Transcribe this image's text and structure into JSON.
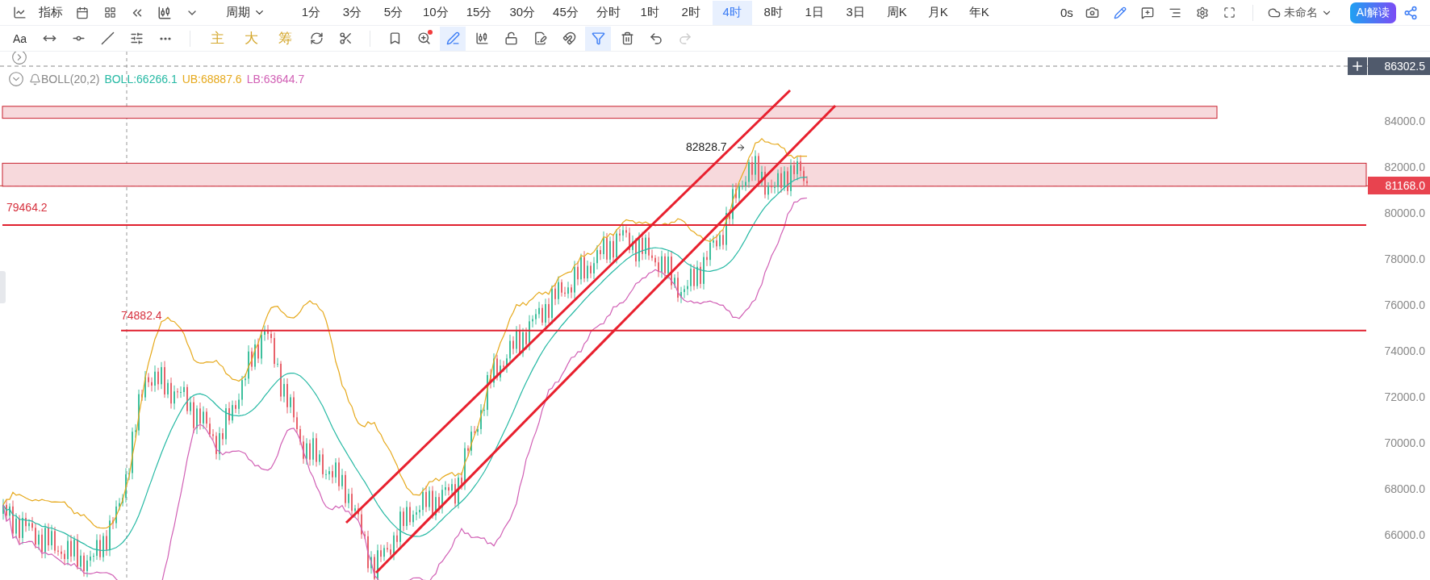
{
  "toolbar": {
    "indicator_label": "指标",
    "period_label": "周期",
    "periods": [
      {
        "label": "1分",
        "selected": false
      },
      {
        "label": "3分",
        "selected": false
      },
      {
        "label": "5分",
        "selected": false
      },
      {
        "label": "10分",
        "selected": false
      },
      {
        "label": "15分",
        "selected": false
      },
      {
        "label": "30分",
        "selected": false
      },
      {
        "label": "45分",
        "selected": false
      },
      {
        "label": "分时",
        "selected": false
      },
      {
        "label": "1时",
        "selected": false
      },
      {
        "label": "2时",
        "selected": false
      },
      {
        "label": "4时",
        "selected": true
      },
      {
        "label": "8时",
        "selected": false
      },
      {
        "label": "1日",
        "selected": false
      },
      {
        "label": "3日",
        "selected": false
      },
      {
        "label": "周K",
        "selected": false
      },
      {
        "label": "月K",
        "selected": false
      },
      {
        "label": "年K",
        "selected": false
      }
    ],
    "timer": "0s",
    "layout_name": "未命名",
    "ai_button": "AI解读"
  },
  "drawing_toolbar": {
    "font_label": "Aa",
    "chips": [
      "主",
      "大",
      "筹"
    ],
    "tools": [
      {
        "selected": false,
        "dot": false
      },
      {
        "selected": false,
        "dot": false
      },
      {
        "selected": false,
        "dot": false
      },
      {
        "selected": false,
        "dot": false
      },
      {
        "selected": false,
        "dot": false
      },
      {
        "selected": false,
        "dot": false
      },
      {
        "selected": false,
        "dot": false
      },
      {
        "selected": false,
        "dot": false
      },
      {
        "selected": false,
        "dot": true
      },
      {
        "selected": true,
        "dot": false
      },
      {
        "selected": false,
        "dot": false
      },
      {
        "selected": false,
        "dot": false
      },
      {
        "selected": false,
        "dot": false
      },
      {
        "selected": false,
        "dot": false
      },
      {
        "selected": true,
        "dot": false
      },
      {
        "selected": false,
        "dot": false
      }
    ],
    "history": [
      {
        "disabled": false
      },
      {
        "disabled": true
      }
    ]
  },
  "indicator": {
    "name": "BOLL(20,2)",
    "values": [
      {
        "label": "BOLL:66266.1",
        "color": "#26b9a4"
      },
      {
        "label": "UB:68887.6",
        "color": "#e6a91c"
      },
      {
        "label": "LB:63644.7",
        "color": "#d160b5"
      }
    ]
  },
  "chart": {
    "level_labels": [
      "79464.2",
      "74882.4"
    ],
    "high_label": "82828.7"
  },
  "price_axis": {
    "ticks": [
      "84000.0",
      "82000.0",
      "80000.0",
      "78000.0",
      "76000.0",
      "74000.0",
      "72000.0",
      "70000.0",
      "68000.0",
      "66000.0"
    ],
    "crosshair_price": "86302.5",
    "last_price": "81168.0"
  }
}
